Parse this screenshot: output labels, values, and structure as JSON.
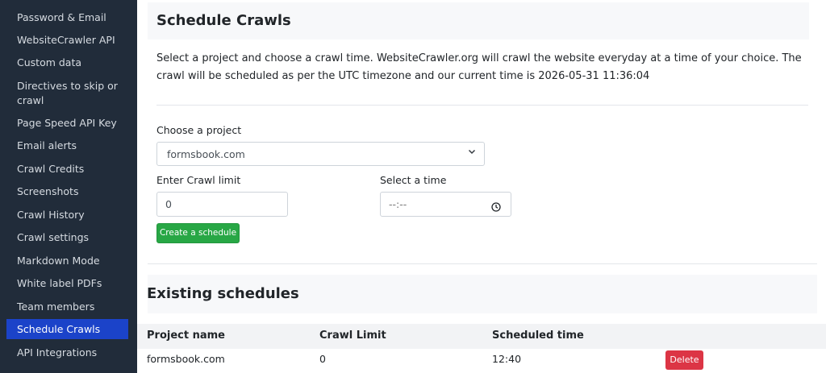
{
  "sidebar": {
    "items": [
      {
        "label": "Password & Email"
      },
      {
        "label": "WebsiteCrawler API"
      },
      {
        "label": "Custom data"
      },
      {
        "label": "Directives to skip or crawl"
      },
      {
        "label": "Page Speed API Key"
      },
      {
        "label": "Email alerts"
      },
      {
        "label": "Crawl Credits"
      },
      {
        "label": "Screenshots"
      },
      {
        "label": "Crawl History"
      },
      {
        "label": "Crawl settings"
      },
      {
        "label": "Markdown Mode"
      },
      {
        "label": "White label PDFs"
      },
      {
        "label": "Team members"
      },
      {
        "label": "Schedule Crawls"
      },
      {
        "label": "API Integrations"
      }
    ],
    "active": "Schedule Crawls"
  },
  "main": {
    "title": "Schedule Crawls",
    "description": "Select a project and choose a crawl time. WebsiteCrawler.org will crawl the website everyday at a time of your choice. The crawl will be scheduled as per the UTC timezone and our current time is 2026-05-31 11:36:04",
    "project_label": "Choose a project",
    "project_value": "formsbook.com",
    "crawl_limit_label": "Enter Crawl limit",
    "crawl_limit_value": "0",
    "time_label": "Select a time",
    "time_placeholder": "--:--",
    "create_button": "Create a schedule"
  },
  "schedules": {
    "title": "Existing schedules",
    "columns": [
      "Project name",
      "Crawl Limit",
      "Scheduled time"
    ],
    "rows": [
      {
        "project": "formsbook.com",
        "limit": "0",
        "time": "12:40",
        "action": "Delete"
      }
    ]
  },
  "colors": {
    "sidebar_bg": "#212c3a",
    "active_item": "#1b43c9",
    "create_button": "#28a745",
    "delete_button": "#dc3545"
  }
}
